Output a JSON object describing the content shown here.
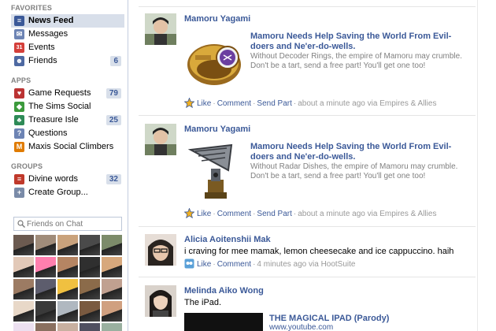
{
  "sidebar": {
    "favorites_title": "FAVORITES",
    "favorites": [
      {
        "label": "News Feed",
        "icon": "news-feed-icon",
        "color": "#3b5998",
        "count": "",
        "selected": true
      },
      {
        "label": "Messages",
        "icon": "messages-icon",
        "color": "#6d84b4",
        "count": ""
      },
      {
        "label": "Events",
        "icon": "events-calendar-icon",
        "color": "#d43f3a",
        "count": ""
      },
      {
        "label": "Friends",
        "icon": "friends-icon",
        "color": "#4e69a2",
        "count": "6"
      }
    ],
    "apps_title": "APPS",
    "apps": [
      {
        "label": "Game Requests",
        "icon": "game-requests-icon",
        "color": "#b33",
        "count": "79"
      },
      {
        "label": "The Sims Social",
        "icon": "sims-plumbob-icon",
        "color": "#3c9a3c",
        "count": ""
      },
      {
        "label": "Treasure Isle",
        "icon": "palm-tree-icon",
        "color": "#2e8b57",
        "count": "25"
      },
      {
        "label": "Questions",
        "icon": "questions-icon",
        "color": "#6d84b4",
        "count": ""
      },
      {
        "label": "Maxis Social Climbers",
        "icon": "maxis-icon",
        "color": "#e07b00",
        "count": ""
      }
    ],
    "groups_title": "GROUPS",
    "groups": [
      {
        "label": "Divine words",
        "icon": "group-icon",
        "color": "#c0392b",
        "count": "32"
      },
      {
        "label": "Create Group...",
        "icon": "create-group-icon",
        "color": "#7a8ba8",
        "count": ""
      }
    ],
    "chat_placeholder": "Friends on Chat",
    "friend_colors": [
      "#6b5a50",
      "#a08c7a",
      "#c9a27c",
      "#4a4a4a",
      "#7c8b6a",
      "#e2c9b8",
      "#ff7fae",
      "#b58563",
      "#2f2f2f",
      "#d7a87c",
      "#9c7b63",
      "#5d5d6d",
      "#f0c040",
      "#8b6b4a",
      "#c0a090",
      "#e8d8c8",
      "#3a3a3a",
      "#b0b8c0",
      "#7a5a40",
      "#d0a080",
      "#ece0f0",
      "#8a7060",
      "#c8b0a0",
      "#505060",
      "#9ab0a0"
    ]
  },
  "feed": {
    "stories": [
      {
        "author": "Mamoru Yagami",
        "attachment_title": "Mamoru Needs Help Saving the World From Evil-doers and Ne'er-do-wells.",
        "attachment_desc": "Without Decoder Rings, the empire of Mamoru may crumble. Don't be a tart, send a free part! You'll get one too!",
        "attachment_image": "decoder-ring-icon",
        "actions": {
          "like": "Like",
          "comment": "Comment",
          "send": "Send Part",
          "meta": "about a minute ago via Empires & Allies"
        }
      },
      {
        "author": "Mamoru Yagami",
        "attachment_title": "Mamoru Needs Help Saving the World From Evil-doers and Ne'er-do-wells.",
        "attachment_desc": "Without Radar Dishes, the empire of Mamoru may crumble. Don't be a tart, send a free part! You'll get one too!",
        "attachment_image": "radar-dish-icon",
        "actions": {
          "like": "Like",
          "comment": "Comment",
          "send": "Send Part",
          "meta": "about a minute ago via Empires & Allies"
        }
      },
      {
        "author": "Alicia Aoitenshii Mak",
        "message": "i craving for mee mamak, lemon cheesecake and ice cappuccino. haih",
        "actions": {
          "like": "Like",
          "comment": "Comment",
          "meta": "4 minutes ago via HootSuite"
        }
      },
      {
        "author": "Melinda Aiko Wong",
        "message": "The iPad.",
        "video_title": "THE MAGICAL IPAD (Parody)",
        "video_url": "www.youtube.com"
      }
    ]
  },
  "colors": {
    "link": "#3b5998",
    "selected_bg": "#d8dfea",
    "muted": "#808080"
  }
}
